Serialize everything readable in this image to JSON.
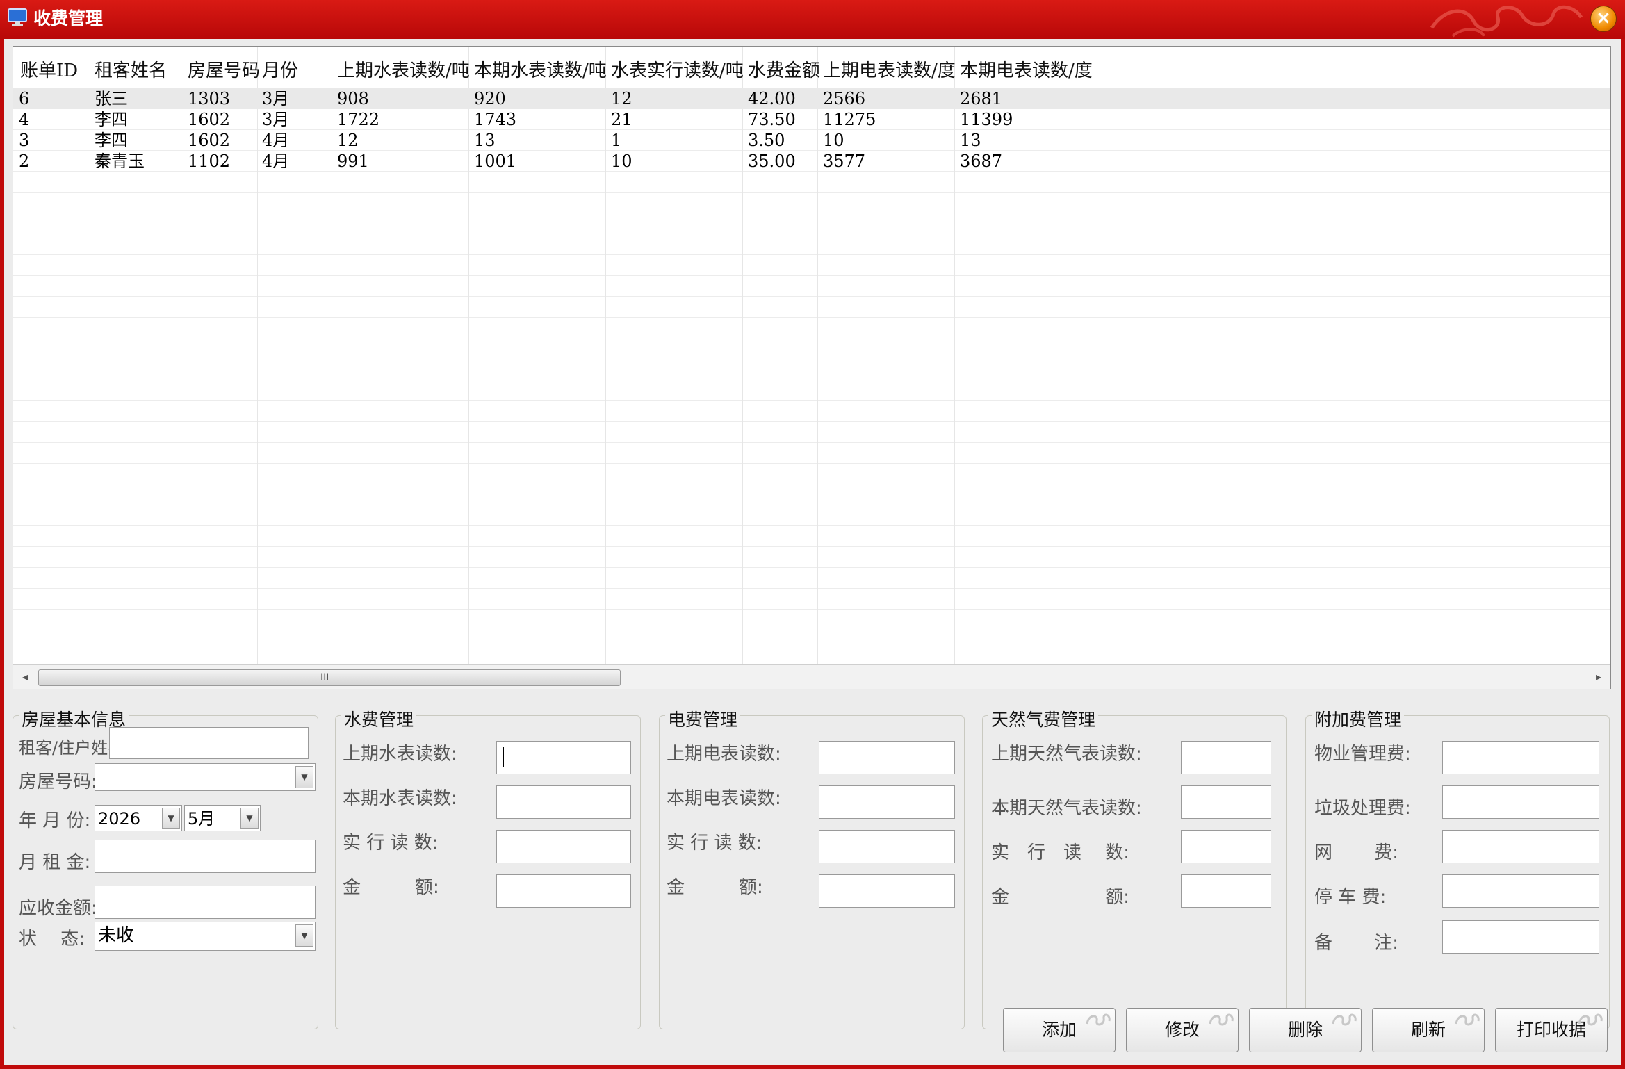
{
  "window": {
    "title": "收费管理",
    "close_symbol": "×"
  },
  "table": {
    "columns": [
      "账单ID",
      "租客姓名",
      "房屋号码",
      "月份",
      "上期水表读数/吨",
      "本期水表读数/吨",
      "水表实行读数/吨",
      "水费金额",
      "上期电表读数/度",
      "本期电表读数/度"
    ],
    "rows": [
      [
        "6",
        "张三",
        "1303",
        "3月",
        "908",
        "920",
        "12",
        "42.00",
        "2566",
        "2681"
      ],
      [
        "4",
        "李四",
        "1602",
        "3月",
        "1722",
        "1743",
        "21",
        "73.50",
        "11275",
        "11399"
      ],
      [
        "3",
        "李四",
        "1602",
        "4月",
        "12",
        "13",
        "1",
        "3.50",
        "10",
        "13"
      ],
      [
        "2",
        "秦青玉",
        "1102",
        "4月",
        "991",
        "1001",
        "10",
        "35.00",
        "3577",
        "3687"
      ]
    ],
    "scroll_arrow_left": "◂",
    "scroll_arrow_right": "▸",
    "scroll_grip": "III"
  },
  "house": {
    "title": "房屋基本信息",
    "tenant_label": "租客/住户姓名:",
    "tenant_value": "",
    "room_label": "房屋号码:",
    "room_value": "",
    "month_label": "年 月 份:",
    "year_value": "2026",
    "month_value": "5月",
    "rent_label": "月 租 金:",
    "rent_value": "",
    "due_label": "应收金额:",
    "due_value": "",
    "status_label": "状　 态:",
    "status_value": "未收"
  },
  "water": {
    "title": "水费管理",
    "prev_label": "上期水表读数:",
    "cur_label": "本期水表读数:",
    "actual_label": "实 行  读 数:",
    "amount_label": "金　　　额:"
  },
  "electric": {
    "title": "电费管理",
    "prev_label": "上期电表读数:",
    "cur_label": "本期电表读数:",
    "actual_label": "实 行  读 数:",
    "amount_label": "金　　　额:"
  },
  "gas": {
    "title": "天然气费管理",
    "prev_label": "上期天然气表读数:",
    "cur_label": "本期天然气表读数:",
    "actual_label": "实　行　读　 数:",
    "amount_label": "金　　　　　 额:"
  },
  "extra": {
    "title": "附加费管理",
    "property_label": "物业管理费:",
    "garbage_label": "垃圾处理费:",
    "net_label": "网　　 费:",
    "parking_label": "停 车 费:",
    "note_label": "备　　 注:"
  },
  "buttons": {
    "add": "添加",
    "edit": "修改",
    "delete": "删除",
    "refresh": "刷新",
    "print": "打印收据"
  },
  "colors": {
    "titlebar": "#c00a0a",
    "panel": "#ececec",
    "selected_row": "#e9e9e9"
  }
}
